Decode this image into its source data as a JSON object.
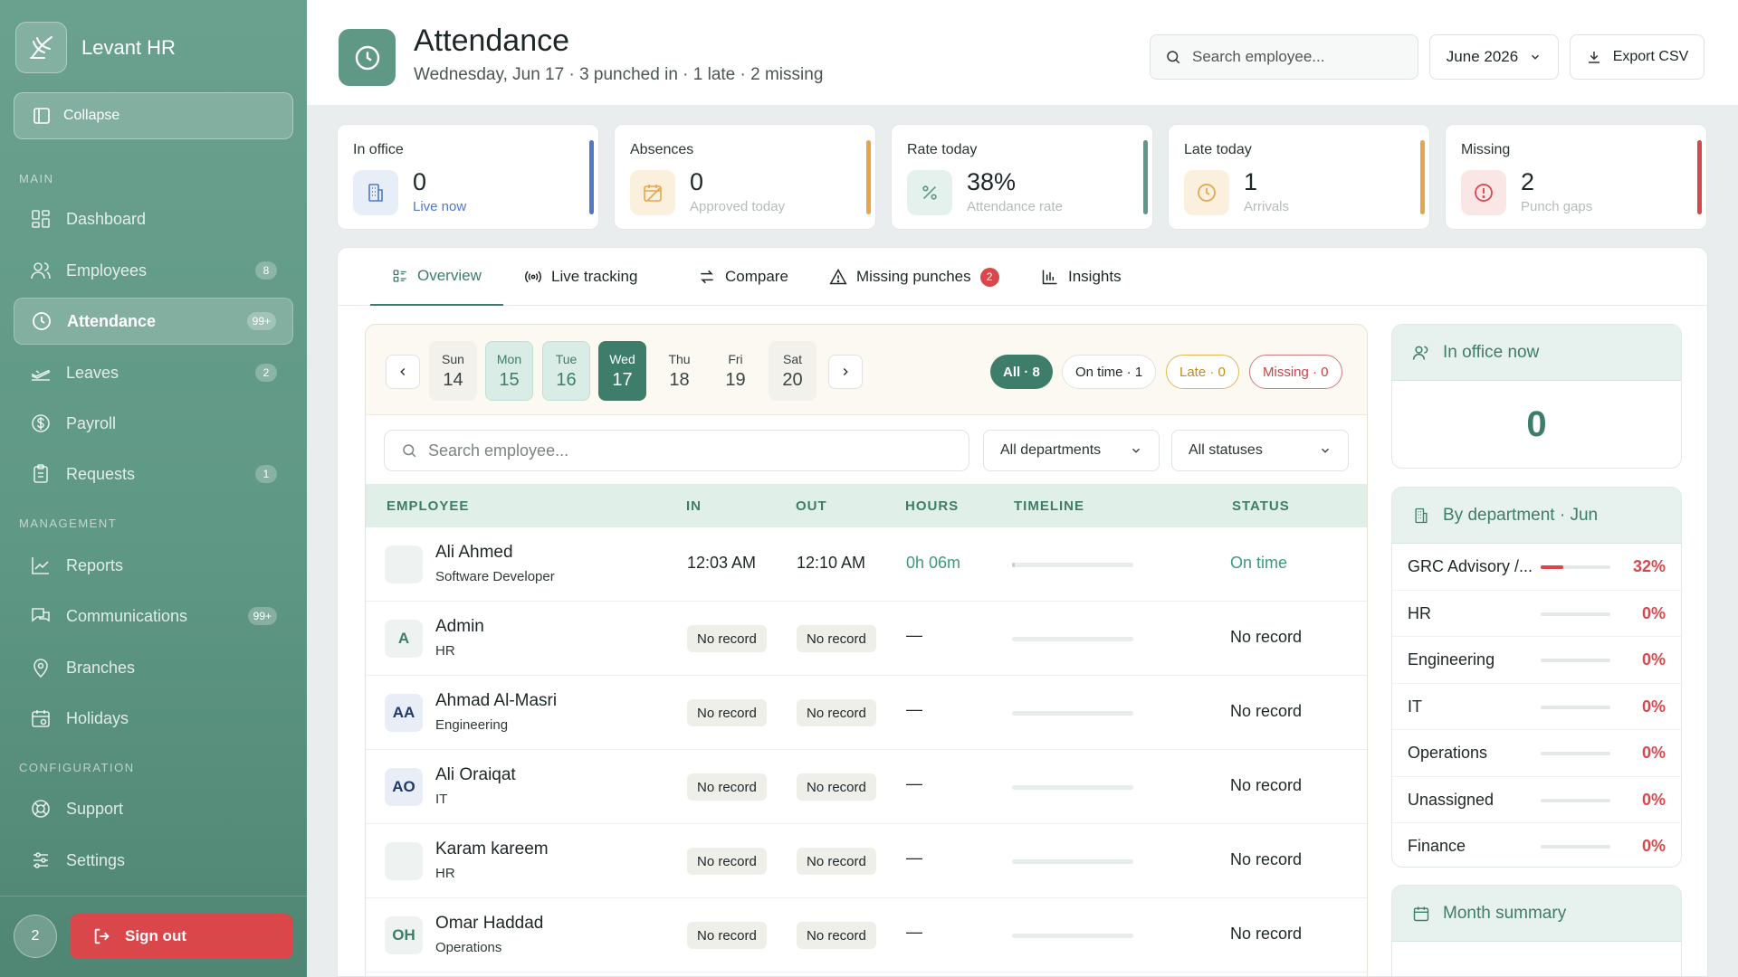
{
  "app": {
    "brand": "Levant HR",
    "collapse_label": "Collapse"
  },
  "sidebar": {
    "sections": {
      "main": "MAIN",
      "management": "MANAGEMENT",
      "configuration": "CONFIGURATION"
    },
    "items": [
      {
        "label": "Dashboard",
        "icon": "dashboard-icon",
        "badge": ""
      },
      {
        "label": "Employees",
        "icon": "users-icon",
        "badge": "8"
      },
      {
        "label": "Attendance",
        "icon": "clock-icon",
        "badge": "99+"
      },
      {
        "label": "Leaves",
        "icon": "plane-icon",
        "badge": "2"
      },
      {
        "label": "Payroll",
        "icon": "dollar-icon",
        "badge": ""
      },
      {
        "label": "Requests",
        "icon": "clipboard-icon",
        "badge": "1"
      },
      {
        "label": "Reports",
        "icon": "chart-line-icon",
        "badge": ""
      },
      {
        "label": "Communications",
        "icon": "chat-icon",
        "badge": "99+"
      },
      {
        "label": "Branches",
        "icon": "map-pin-icon",
        "badge": ""
      },
      {
        "label": "Holidays",
        "icon": "calendar-icon",
        "badge": ""
      },
      {
        "label": "Support",
        "icon": "lifebuoy-icon",
        "badge": ""
      },
      {
        "label": "Settings",
        "icon": "sliders-icon",
        "badge": ""
      }
    ],
    "user_initial": "2",
    "signout_label": "Sign out"
  },
  "header": {
    "title": "Attendance",
    "subtitle": "Wednesday, Jun 17 · 3 punched in · 1 late · 2 missing",
    "search_placeholder": "Search employee...",
    "month": "June 2026",
    "export_label": "Export CSV"
  },
  "stats": [
    {
      "label": "In office",
      "value": "0",
      "sub": "Live now",
      "accent": "#4f79c4"
    },
    {
      "label": "Absences",
      "value": "0",
      "sub": "Approved today",
      "accent": "#e4a64a"
    },
    {
      "label": "Rate today",
      "value": "38%",
      "sub": "Attendance rate",
      "accent": "#5f9885"
    },
    {
      "label": "Late today",
      "value": "1",
      "sub": "Arrivals",
      "accent": "#e4a64a"
    },
    {
      "label": "Missing",
      "value": "2",
      "sub": "Punch gaps",
      "accent": "#d9474b"
    }
  ],
  "tabs": [
    {
      "label": "Overview",
      "icon": "list-icon"
    },
    {
      "label": "Live tracking",
      "icon": "broadcast-icon"
    },
    {
      "label": "Compare",
      "icon": "swap-icon"
    },
    {
      "label": "Missing punches",
      "icon": "warning-icon",
      "count": "2"
    },
    {
      "label": "Insights",
      "icon": "bar-chart-icon"
    }
  ],
  "days": [
    {
      "name": "Sun",
      "num": "14",
      "state": "plain"
    },
    {
      "name": "Mon",
      "num": "15",
      "state": "done"
    },
    {
      "name": "Tue",
      "num": "16",
      "state": "done"
    },
    {
      "name": "Wed",
      "num": "17",
      "state": "cur"
    },
    {
      "name": "Thu",
      "num": "18",
      "state": "free"
    },
    {
      "name": "Fri",
      "num": "19",
      "state": "free"
    },
    {
      "name": "Sat",
      "num": "20",
      "state": "plain"
    }
  ],
  "chips": {
    "all": "All · 8",
    "ontime": "On time · 1",
    "late": "Late · 0",
    "missing": "Missing · 0"
  },
  "filters": {
    "search_placeholder": "Search employee...",
    "department": "All departments",
    "status": "All statuses"
  },
  "table": {
    "headers": {
      "employee": "EMPLOYEE",
      "in": "IN",
      "out": "OUT",
      "hours": "HOURS",
      "timeline": "TIMELINE",
      "status": "STATUS"
    },
    "rows": [
      {
        "initials": "",
        "name": "Ali Ahmed",
        "role": "Software Developer",
        "in": "12:03 AM",
        "out": "12:10 AM",
        "hours": "0h 06m",
        "timeline_fill": 0.01,
        "status": "On time"
      },
      {
        "initials": "A",
        "name": "Admin",
        "role": "HR",
        "in": "No record",
        "out": "No record",
        "hours": "—",
        "timeline_fill": 0,
        "status": "No record"
      },
      {
        "initials": "AA",
        "name": "Ahmad Al-Masri",
        "role": "Engineering",
        "in": "No record",
        "out": "No record",
        "hours": "—",
        "timeline_fill": 0,
        "status": "No record"
      },
      {
        "initials": "AO",
        "name": "Ali Oraiqat",
        "role": "IT",
        "in": "No record",
        "out": "No record",
        "hours": "—",
        "timeline_fill": 0,
        "status": "No record"
      },
      {
        "initials": "",
        "name": "Karam kareem",
        "role": "HR",
        "in": "No record",
        "out": "No record",
        "hours": "—",
        "timeline_fill": 0,
        "status": "No record"
      },
      {
        "initials": "OH",
        "name": "Omar Haddad",
        "role": "Operations",
        "in": "No record",
        "out": "No record",
        "hours": "—",
        "timeline_fill": 0,
        "status": "No record"
      }
    ]
  },
  "in_office": {
    "title": "In office now",
    "value": "0"
  },
  "by_department": {
    "title": "By department · Jun",
    "rows": [
      {
        "name": "GRC Advisory /...",
        "pct": "32%",
        "fill": 0.32
      },
      {
        "name": "HR",
        "pct": "0%",
        "fill": 0
      },
      {
        "name": "Engineering",
        "pct": "0%",
        "fill": 0
      },
      {
        "name": "IT",
        "pct": "0%",
        "fill": 0
      },
      {
        "name": "Operations",
        "pct": "0%",
        "fill": 0
      },
      {
        "name": "Unassigned",
        "pct": "0%",
        "fill": 0
      },
      {
        "name": "Finance",
        "pct": "0%",
        "fill": 0
      }
    ]
  },
  "month_summary": {
    "title": "Month summary"
  }
}
